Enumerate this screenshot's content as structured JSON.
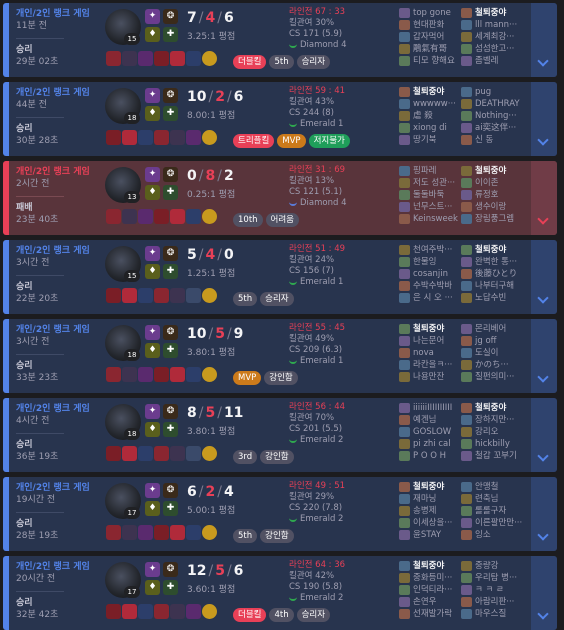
{
  "matches": [
    {
      "queue": "개인/2인 랭크 게임",
      "ago": "11분 전",
      "result": "승리",
      "duration": "29분 02초",
      "outcome": "win",
      "level": "15",
      "kills": "7",
      "deaths": "4",
      "assists": "6",
      "ratio": "3.25:1 평점",
      "tags": [
        {
          "text": "더블킬",
          "style": "red"
        },
        {
          "text": "5th",
          "style": "gray"
        },
        {
          "text": "승리자",
          "style": "gray"
        }
      ],
      "kill_participation": "킬관여 30%",
      "cs": "CS 171 (5.9)",
      "rank": "Diamond 4",
      "lane": "라인전 67 : 33",
      "team1": [
        "top gone",
        "현대판화",
        "갑자먹어",
        "鵰氣有哥",
        "티모 향해요"
      ],
      "team2": [
        "철퇴중야",
        "lll mann···",
        "세계최강···",
        "섬섬한고···",
        "좀벨레"
      ],
      "empty_slots": []
    },
    {
      "queue": "개인/2인 랭크 게임",
      "ago": "44분 전",
      "result": "승리",
      "duration": "30분 28초",
      "outcome": "win",
      "level": "18",
      "kills": "10",
      "deaths": "2",
      "assists": "6",
      "ratio": "8.00:1 평점",
      "tags": [
        {
          "text": "트리플킬",
          "style": "red"
        },
        {
          "text": "MVP",
          "style": "orange"
        },
        {
          "text": "저지불가",
          "style": "green"
        }
      ],
      "kill_participation": "킬관여 43%",
      "cs": "CS 244 (8)",
      "rank": "Emerald 1",
      "lane": "라인전 59 : 41",
      "team1": [
        "철퇴중야",
        "wwwww···",
        "虐 殺",
        "xiong di",
        "땅기북"
      ],
      "team2": [
        "pug",
        "DEATHRAY",
        "Nothing···",
        "ai奕这伴···",
        "신 동"
      ],
      "empty_slots": []
    },
    {
      "queue": "개인/2인 랭크 게임",
      "ago": "2시간 전",
      "result": "패배",
      "duration": "23분 40초",
      "outcome": "loss",
      "level": "13",
      "kills": "0",
      "deaths": "8",
      "assists": "2",
      "ratio": "0.25:1 평점",
      "tags": [
        {
          "text": "10th",
          "style": "gray"
        },
        {
          "text": "어려움",
          "style": "gray"
        }
      ],
      "kill_participation": "킬관여 13%",
      "cs": "CS 121 (5.1)",
      "rank": "Diamond 4",
      "lane": "라인전 31 : 69",
      "team1": [
        "핑파레",
        "저도 성관···",
        "둘둘바둑",
        "넌무스트···",
        "Keinsweek"
      ],
      "team2": [
        "철퇴중야",
        "이이존",
        "류정호",
        "생수이랑",
        "장림풍그렘"
      ],
      "empty_slots": []
    },
    {
      "queue": "개인/2인 랭크 게임",
      "ago": "3시간 전",
      "result": "승리",
      "duration": "22분 20초",
      "outcome": "win",
      "level": "15",
      "kills": "5",
      "deaths": "4",
      "assists": "0",
      "ratio": "1.25:1 평점",
      "tags": [
        {
          "text": "5th",
          "style": "gray"
        },
        {
          "text": "승리자",
          "style": "gray"
        }
      ],
      "kill_participation": "킬관여 24%",
      "cs": "CS 156 (7)",
      "rank": "Emerald 1",
      "lane": "라인전 51 : 49",
      "team1": [
        "천여주박···",
        "한물잉",
        "cosanjin",
        "수박수박바",
        "은 시 오 ···"
      ],
      "team2": [
        "철퇴중야",
        "완벽한 통···",
        "後藤ひとり",
        "나부터구해",
        "노답수빈"
      ],
      "empty_slots": [
        5
      ]
    },
    {
      "queue": "개인/2인 랭크 게임",
      "ago": "3시간 전",
      "result": "승리",
      "duration": "33분 23초",
      "outcome": "win",
      "level": "18",
      "kills": "10",
      "deaths": "5",
      "assists": "9",
      "ratio": "3.80:1 평점",
      "tags": [
        {
          "text": "MVP",
          "style": "orange"
        },
        {
          "text": "강인함",
          "style": "gray"
        }
      ],
      "kill_participation": "킬관여 49%",
      "cs": "CS 209 (6.3)",
      "rank": "Emerald 1",
      "lane": "라인전 55 : 45",
      "team1": [
        "철퇴중야",
        "나는문어",
        "nova",
        "라칸을ㅋ···",
        "나용만잔"
      ],
      "team2": [
        "몬리베어",
        "jg off",
        "도실이",
        "かのち···",
        "질펀의미···"
      ],
      "empty_slots": []
    },
    {
      "queue": "개인/2인 랭크 게임",
      "ago": "4시간 전",
      "result": "승리",
      "duration": "36분 19초",
      "outcome": "win",
      "level": "18",
      "kills": "8",
      "deaths": "5",
      "assists": "11",
      "ratio": "3.80:1 평점",
      "tags": [
        {
          "text": "3rd",
          "style": "gray"
        },
        {
          "text": "강인함",
          "style": "gray"
        }
      ],
      "kill_participation": "킬관여 70%",
      "cs": "CS 201 (5.5)",
      "rank": "Emerald 2",
      "lane": "라인전 56 : 44",
      "team1": [
        "iiiiiiIIIIIIIIII",
        "예겐님",
        "GOSLOW",
        "pi zhi cal",
        "P O O H"
      ],
      "team2": [
        "철퇴중야",
        "장하지만···",
        "강리오",
        "hickbilly",
        "철갑 꼬부기"
      ],
      "empty_slots": [
        5
      ]
    },
    {
      "queue": "개인/2인 랭크 게임",
      "ago": "19시간 전",
      "result": "승리",
      "duration": "28분 19초",
      "outcome": "win",
      "level": "17",
      "kills": "6",
      "deaths": "2",
      "assists": "4",
      "ratio": "5.00:1 평점",
      "tags": [
        {
          "text": "5th",
          "style": "gray"
        },
        {
          "text": "강인함",
          "style": "gray"
        }
      ],
      "kill_participation": "킬관여 29%",
      "cs": "CS 220 (7.8)",
      "rank": "Emerald 2",
      "lane": "라인전 49 : 51",
      "team1": [
        "철퇴중야",
        "재마닝",
        "송병제",
        "이세상을···",
        "윤STAY"
      ],
      "team2": [
        "안맹철",
        "련축님",
        "롤롤구자",
        "이른팔만만···",
        "잉소"
      ],
      "empty_slots": []
    },
    {
      "queue": "개인/2인 랭크 게임",
      "ago": "20시간 전",
      "result": "승리",
      "duration": "32분 42초",
      "outcome": "win",
      "level": "17",
      "kills": "12",
      "deaths": "5",
      "assists": "6",
      "ratio": "3.60:1 평점",
      "tags": [
        {
          "text": "더블킬",
          "style": "red"
        },
        {
          "text": "4th",
          "style": "gray"
        },
        {
          "text": "승리자",
          "style": "gray"
        }
      ],
      "kill_participation": "킬관여 42%",
      "cs": "CS 190 (5.8)",
      "rank": "Emerald 2",
      "lane": "라인전 64 : 36",
      "team1": [
        "철퇴중야",
        "중화등미···",
        "인덕티라···",
        "손연우",
        "선재발가락"
      ],
      "team2": [
        "중량강",
        "우리탐 병···",
        "ㅋ ㅋ ㄹ",
        "아람리판···",
        "마우스질"
      ],
      "empty_slots": []
    }
  ],
  "colors": {
    "win_bg": "#28344e",
    "loss_bg": "#59343b",
    "win_accent": "#5383e8",
    "loss_accent": "#e84057",
    "mvp": "#cc7a1a",
    "multikill": "#e84057",
    "unstoppable": "#1f9e5a"
  },
  "icons": {
    "expand": "chevron-down-icon",
    "champion": "champion-portrait-icon",
    "rank": "rank-emblem-icon",
    "spell": "summoner-spell-icon",
    "rune": "rune-icon",
    "item": "item-icon"
  }
}
